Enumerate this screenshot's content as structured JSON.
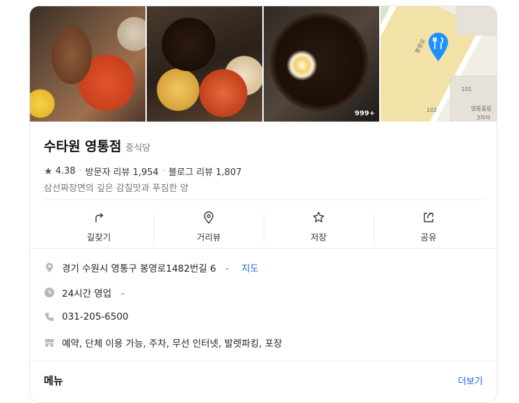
{
  "photos": {
    "count_badge": "999+",
    "map_labels": [
      "봉영로",
      "101",
      "102",
      "영통품림",
      "3차아"
    ]
  },
  "place": {
    "name": "수타원 영통점",
    "category": "중식당",
    "rating": "4.38",
    "visitor_reviews": "방문자 리뷰 1,954",
    "blog_reviews": "블로그 리뷰 1,807",
    "description": "삼선짜장면의 깊은 감칠맛과 푸짐한 양"
  },
  "actions": [
    {
      "label": "길찾기",
      "icon": "directions-icon"
    },
    {
      "label": "거리뷰",
      "icon": "street-view-icon"
    },
    {
      "label": "저장",
      "icon": "star-icon"
    },
    {
      "label": "공유",
      "icon": "share-icon"
    }
  ],
  "details": {
    "address": "경기 수원시 영통구 봉영로1482번길 6",
    "map_link": "지도",
    "hours": "24시간 영업",
    "phone": "031-205-6500",
    "amenities": "예약, 단체 이용 가능, 주차, 무선 인터넷, 발렛파킹, 포장"
  },
  "menu": {
    "heading": "메뉴",
    "more": "더보기"
  },
  "colors": {
    "link": "#1a62d9",
    "pin": "#1e90ff"
  }
}
